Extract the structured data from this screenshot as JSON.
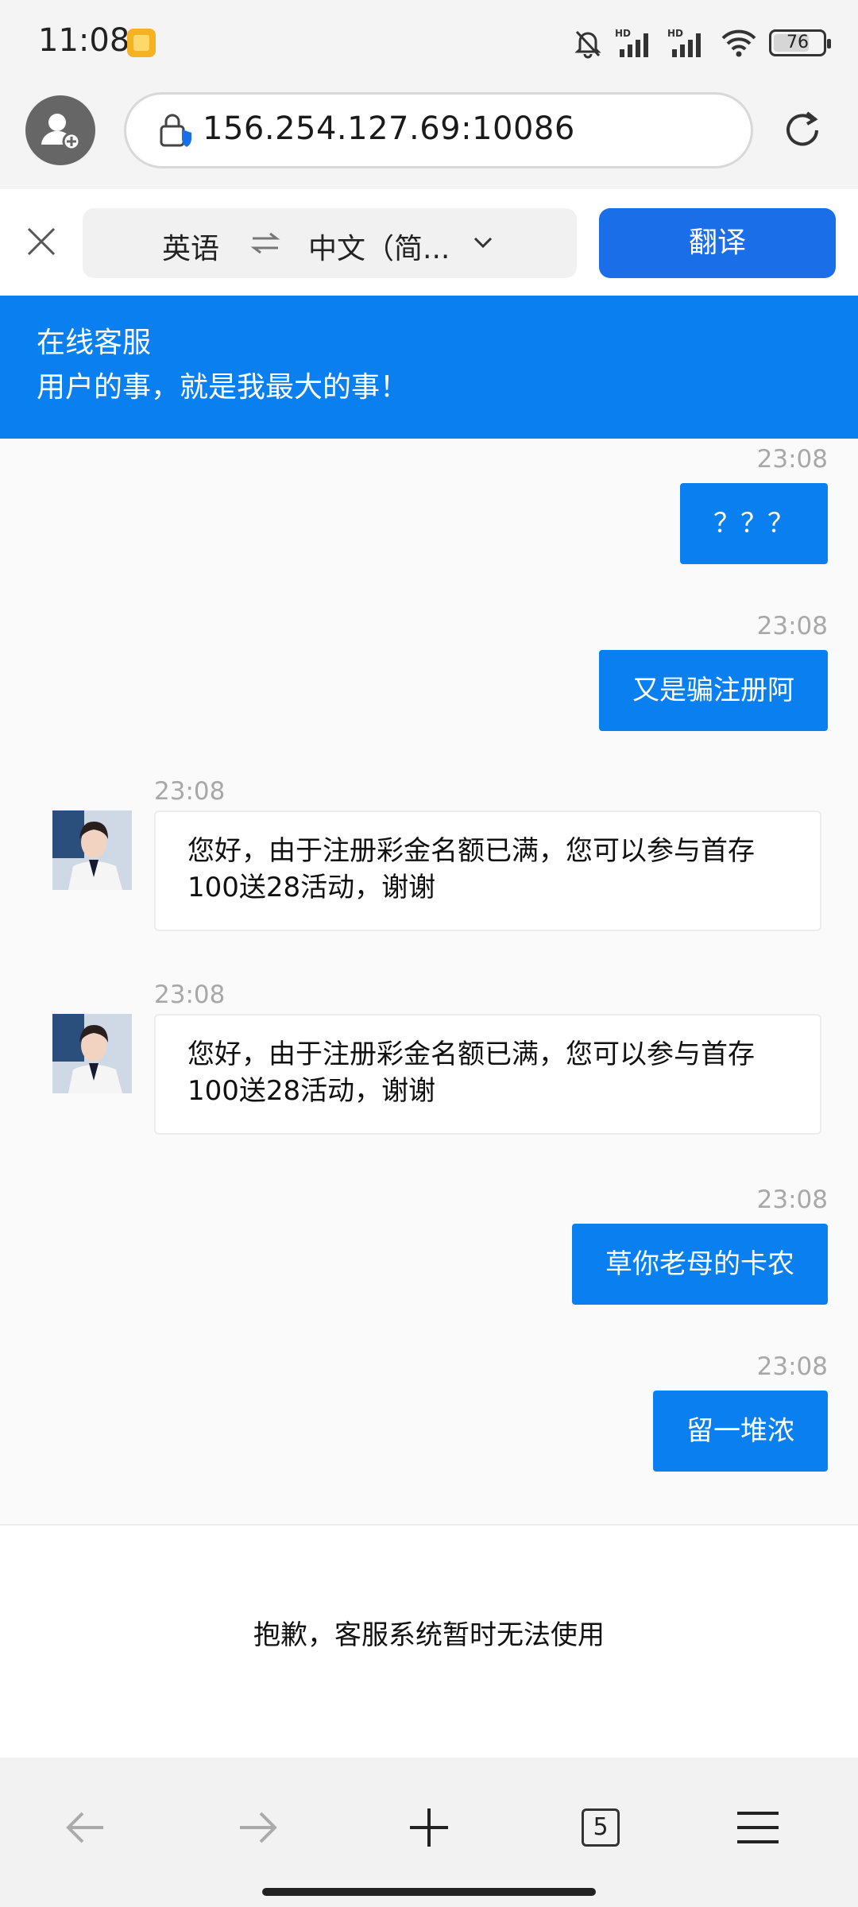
{
  "status_bar": {
    "time": "11:08",
    "battery": "76",
    "battery_level": 0.76,
    "icons": [
      "app-notification-icon",
      "mute-bell-icon",
      "hd-signal-icon",
      "hd-signal-icon",
      "wifi-icon",
      "battery-icon"
    ]
  },
  "browser": {
    "url": "156.254.127.69:10086",
    "account_icon": "person-add-icon",
    "security_icon": "lock-shield-icon",
    "reload_icon": "reload-icon"
  },
  "translate_bar": {
    "source_lang": "英语",
    "target_lang": "中文（简...",
    "translate_label": "翻译",
    "accent": "#1a6fe8"
  },
  "chat_header": {
    "title": "在线客服",
    "subtitle": "用户的事，就是我最大的事！",
    "color": "#0a80f0"
  },
  "messages": [
    {
      "from": "user",
      "time": "23:08",
      "text": "？？？"
    },
    {
      "from": "user",
      "time": "23:08",
      "text": "又是骗注册阿"
    },
    {
      "from": "agent",
      "time": "23:08",
      "text": "您好，由于注册彩金名额已满，您可以参与首存100送28活动，谢谢"
    },
    {
      "from": "agent",
      "time": "23:08",
      "text": "您好，由于注册彩金名额已满，您可以参与首存100送28活动，谢谢"
    },
    {
      "from": "user",
      "time": "23:08",
      "text": "草你老母的卡农"
    },
    {
      "from": "user",
      "time": "23:08",
      "text": "留一堆浓"
    }
  ],
  "footer_notice": "抱歉，客服系统暂时无法使用",
  "bottom_nav": {
    "tabs_count": "5",
    "icons": [
      "back-arrow-icon",
      "forward-arrow-icon",
      "new-tab-plus-icon",
      "tabs-icon",
      "menu-icon"
    ]
  }
}
